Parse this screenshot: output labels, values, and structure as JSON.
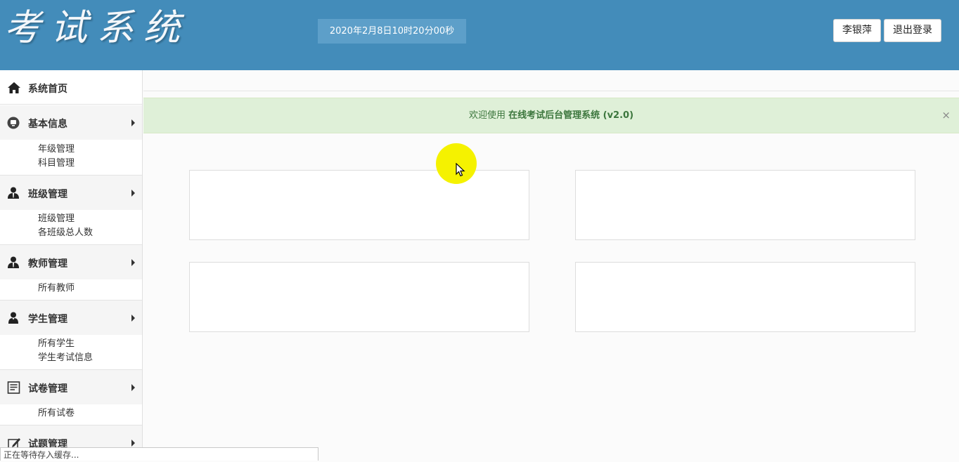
{
  "header": {
    "logo": "考试系统",
    "datetime": "2020年2月8日10时20分00秒",
    "user_label": "李银萍",
    "logout_label": "退出登录",
    "bg_color": "#438cba"
  },
  "sidebar": {
    "home": {
      "label": "系统首页",
      "icon": "home-icon"
    },
    "basic": {
      "label": "基本信息",
      "icon": "monitor-icon",
      "items": [
        "年级管理",
        "科目管理"
      ]
    },
    "class": {
      "label": "班级管理",
      "icon": "user-icon",
      "items": [
        "班级管理",
        "各班级总人数"
      ]
    },
    "teacher": {
      "label": "教师管理",
      "icon": "user-icon",
      "items": [
        "所有教师"
      ]
    },
    "student": {
      "label": "学生管理",
      "icon": "student-icon",
      "items": [
        "所有学生",
        "学生考试信息"
      ]
    },
    "paper": {
      "label": "试卷管理",
      "icon": "document-icon",
      "items": [
        "所有试卷"
      ]
    },
    "question": {
      "label": "试题管理",
      "icon": "edit-icon"
    }
  },
  "alert": {
    "prefix": "欢迎使用 ",
    "system_name": "在线考试后台管理系统",
    "version": " (v2.0)",
    "close": "×",
    "bg_color": "#dff0d8"
  },
  "statusbar": {
    "text": "正在等待存入缓存..."
  }
}
